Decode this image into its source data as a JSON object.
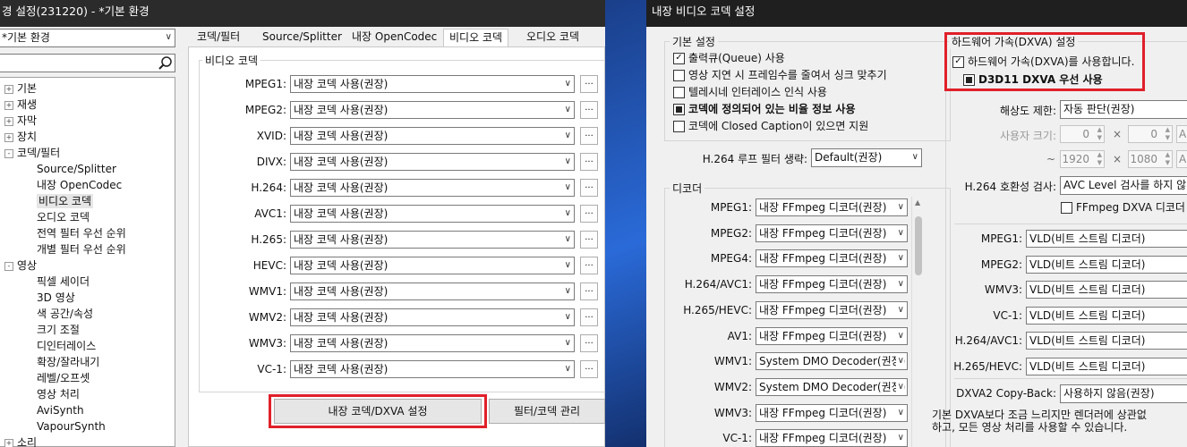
{
  "left": {
    "title": "경 설정(231220) - *기본 환경",
    "profile_combo": "*기본 환경",
    "tree": [
      {
        "label": "기본",
        "exp": "+"
      },
      {
        "label": "재생",
        "exp": "+"
      },
      {
        "label": "자막",
        "exp": "+"
      },
      {
        "label": "장치",
        "exp": "+"
      },
      {
        "label": "코덱/필터",
        "exp": "-"
      },
      {
        "label": "Source/Splitter",
        "exp": ""
      },
      {
        "label": "내장 OpenCodec",
        "exp": ""
      },
      {
        "label": "비디오 코덱",
        "exp": ""
      },
      {
        "label": "오디오 코덱",
        "exp": ""
      },
      {
        "label": "전역 필터 우선 순위",
        "exp": ""
      },
      {
        "label": "개별 필터 우선 순위",
        "exp": ""
      },
      {
        "label": "영상",
        "exp": "-"
      },
      {
        "label": "픽셀 세이더",
        "exp": ""
      },
      {
        "label": "3D 영상",
        "exp": ""
      },
      {
        "label": "색 공간/속성",
        "exp": ""
      },
      {
        "label": "크기 조절",
        "exp": ""
      },
      {
        "label": "디인터레이스",
        "exp": ""
      },
      {
        "label": "확장/잘라내기",
        "exp": ""
      },
      {
        "label": "레벨/오프셋",
        "exp": ""
      },
      {
        "label": "영상 처리",
        "exp": ""
      },
      {
        "label": "AviSynth",
        "exp": ""
      },
      {
        "label": "VapourSynth",
        "exp": ""
      },
      {
        "label": "소리",
        "exp": "+"
      }
    ],
    "tabs": [
      "코덱/필터",
      "Source/Splitter",
      "내장 OpenCodec",
      "비디오 코덱",
      "오디오 코덱"
    ],
    "group_title": "비디오 코덱",
    "codec_rows": [
      {
        "name": "MPEG1:",
        "value": "내장 코덱 사용(권장)"
      },
      {
        "name": "MPEG2:",
        "value": "내장 코덱 사용(권장)"
      },
      {
        "name": "XVID:",
        "value": "내장 코덱 사용(권장)"
      },
      {
        "name": "DIVX:",
        "value": "내장 코덱 사용(권장)"
      },
      {
        "name": "H.264:",
        "value": "내장 코덱 사용(권장)"
      },
      {
        "name": "AVC1:",
        "value": "내장 코덱 사용(권장)"
      },
      {
        "name": "H.265:",
        "value": "내장 코덱 사용(권장)"
      },
      {
        "name": "HEVC:",
        "value": "내장 코덱 사용(권장)"
      },
      {
        "name": "WMV1:",
        "value": "내장 코덱 사용(권장)"
      },
      {
        "name": "WMV2:",
        "value": "내장 코덱 사용(권장)"
      },
      {
        "name": "WMV3:",
        "value": "내장 코덱 사용(권장)"
      },
      {
        "name": "VC-1:",
        "value": "내장 코덱 사용(권장)"
      }
    ],
    "dots_label": "...",
    "btn_dxva": "내장 코덱/DXVA 설정",
    "btn_filter": "필터/코덱 관리"
  },
  "right": {
    "title": "내장 비디오 코덱 설정",
    "basic_title": "기본 설정",
    "basic_checks": [
      {
        "label": "출력큐(Queue) 사용",
        "state": "checked",
        "bold": false
      },
      {
        "label": "영상 지연 시 프레임수를 줄여서 싱크 맞추기",
        "state": "unchecked",
        "bold": false
      },
      {
        "label": "텔레시네 인터레이스 인식 사용",
        "state": "unchecked",
        "bold": false
      },
      {
        "label": "코덱에 정의되어 있는 비율 정보 사용",
        "state": "filled",
        "bold": true
      },
      {
        "label": "코덱에 Closed Caption이 있으면 지원",
        "state": "unchecked",
        "bold": false
      }
    ],
    "h264_loop_label": "H.264 루프 필터 생략:",
    "h264_loop_value": "Default(권장)",
    "decoder_title": "디코더",
    "decoders": [
      {
        "name": "MPEG1:",
        "value": "내장 FFmpeg 디코더(권장)"
      },
      {
        "name": "MPEG2:",
        "value": "내장 FFmpeg 디코더(권장)"
      },
      {
        "name": "MPEG4:",
        "value": "내장 FFmpeg 디코더(권장)"
      },
      {
        "name": "H.264/AVC1:",
        "value": "내장 FFmpeg 디코더(권장)"
      },
      {
        "name": "H.265/HEVC:",
        "value": "내장 FFmpeg 디코더(권장)"
      },
      {
        "name": "AV1:",
        "value": "내장 FFmpeg 디코더(권장)"
      },
      {
        "name": "WMV1:",
        "value": "System DMO Decoder(권장)"
      },
      {
        "name": "WMV2:",
        "value": "System DMO Decoder(권장)"
      },
      {
        "name": "WMV3:",
        "value": "내장 FFmpeg 디코더(권장)"
      },
      {
        "name": "VC-1:",
        "value": "내장 FFmpeg 디코더(권장)"
      }
    ],
    "hw_title": "하드웨어 가속(DXVA) 설정",
    "hw_check": "하드웨어 가속(DXVA)를 사용합니다.",
    "d3d11_check": "D3D11 DXVA 우선 사용",
    "res_label": "해상도 제한:",
    "res_value": "자동 판단(권장)",
    "user_size_label": "사용자 크기:",
    "spin_w1": "0",
    "spin_h1": "0",
    "times": "×",
    "tilde": "~",
    "spin_w2": "1920",
    "spin_h2": "1080",
    "auto_a": "A",
    "h264_compat_label": "H.264 호환성 검사:",
    "h264_compat_value": "AVC Level 검사를 하지 않",
    "ffmpeg_dxva": "FFmpeg DXVA 디코더 사",
    "modes": [
      {
        "name": "MPEG1:",
        "value": "VLD(비트 스트림 디코더)"
      },
      {
        "name": "MPEG2:",
        "value": "VLD(비트 스트림 디코더)"
      },
      {
        "name": "WMV3:",
        "value": "VLD(비트 스트림 디코더)"
      },
      {
        "name": "VC-1:",
        "value": "VLD(비트 스트림 디코더)"
      },
      {
        "name": "H.264/AVC1:",
        "value": "VLD(비트 스트림 디코더)"
      },
      {
        "name": "H.265/HEVC:",
        "value": "VLD(비트 스트림 디코더)"
      }
    ],
    "copyback_label": "DXVA2 Copy-Back:",
    "copyback_value": "사용하지 않음(권장)",
    "note_line1": "기본 DXVA보다 조금 느리지만 렌더러에 상관없",
    "note_line2": "하고, 모든 영상 처리를 사용할 수 있습니다."
  },
  "colors": {
    "highlight_red": "#e0202a",
    "left_title_bg": "#2b2b2b",
    "right_title_bg": "#1f1f1f"
  }
}
